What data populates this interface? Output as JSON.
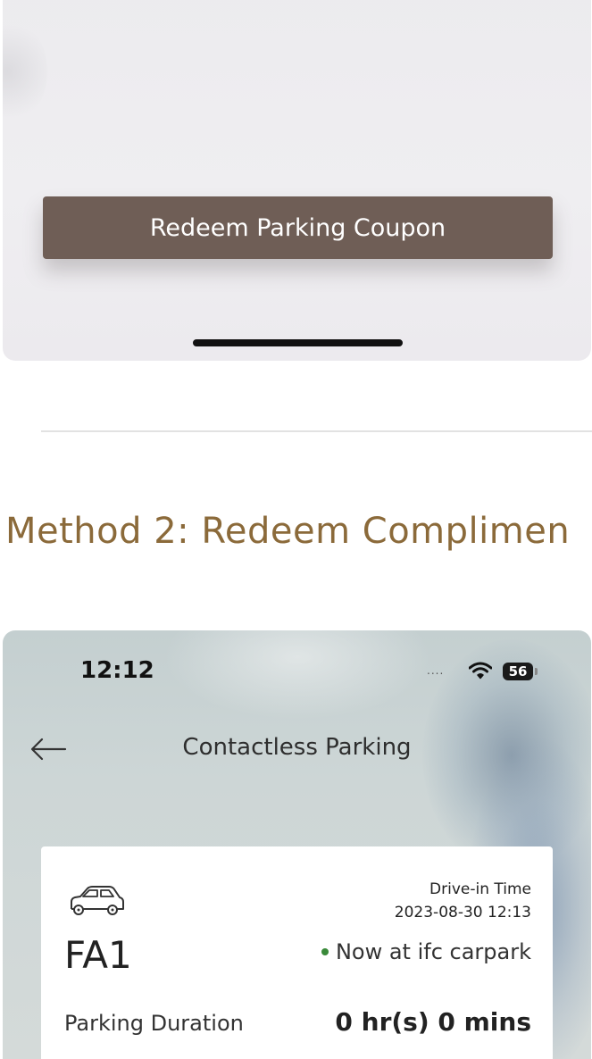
{
  "top_screenshot": {
    "redeem_button_label": "Redeem Parking Coupon"
  },
  "method_heading": "Method 2: Redeem Complimen",
  "bottom_screenshot": {
    "status_bar": {
      "time": "12:12",
      "signal": "....",
      "battery": "56"
    },
    "nav": {
      "title": "Contactless Parking"
    },
    "parking_card": {
      "plate": "FA1",
      "drive_in_label": "Drive-in Time",
      "drive_in_value": "2023-08-30 12:13",
      "location_status": "Now at ifc carpark",
      "duration_label": "Parking Duration",
      "duration_value": "0 hr(s) 0 mins",
      "status_color": "#3a8a3a"
    }
  },
  "colors": {
    "button_bg": "#6f5e56",
    "heading_color": "#8b6a3a"
  }
}
